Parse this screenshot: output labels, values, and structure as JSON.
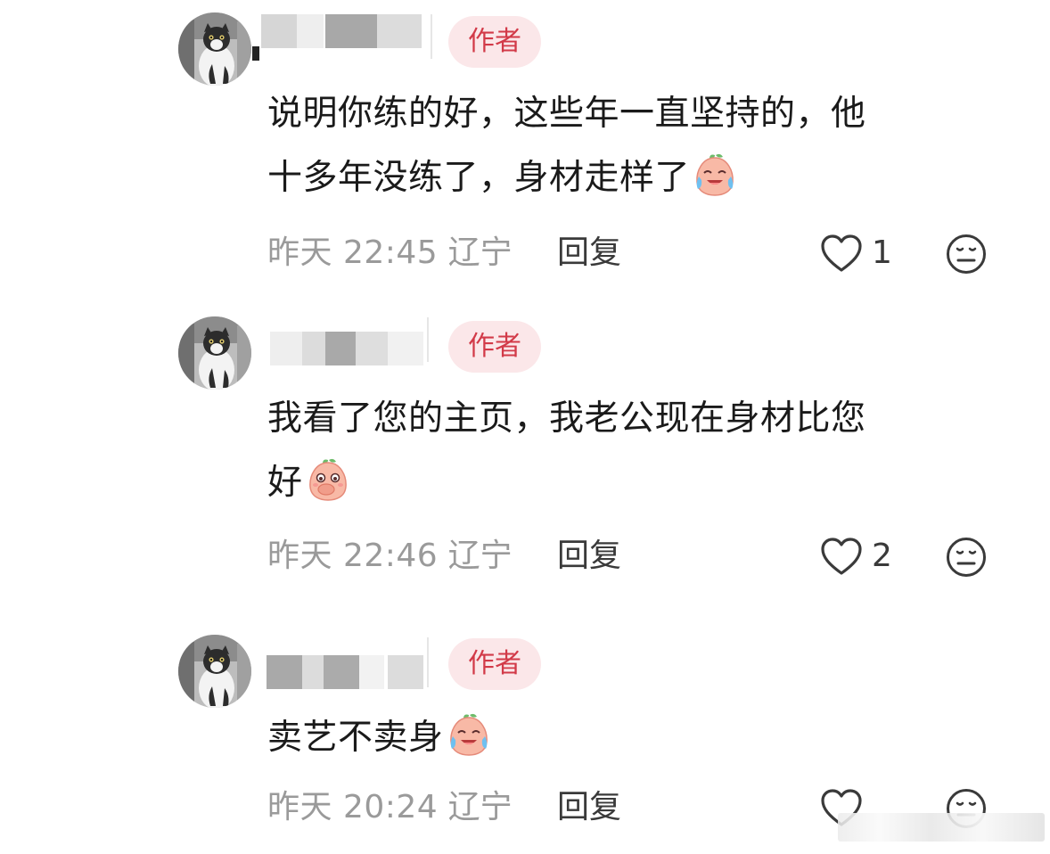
{
  "author_badge_label": "作者",
  "reply_label": "回复",
  "comments": [
    {
      "text_line1": "说明你练的好，这些年一直坚持的，他",
      "text_line2": "十多年没练了，身材走样了",
      "emoji": "crying-laughing-peach-emoji",
      "time": "昨天 22:45",
      "location": "辽宁",
      "like_count": "1"
    },
    {
      "text_line1": "我看了您的主页，我老公现在身材比您",
      "text_line2": "好",
      "emoji": "covering-mouth-peach-emoji",
      "time": "昨天 22:46",
      "location": "辽宁",
      "like_count": "2"
    },
    {
      "text_line1": "卖艺不卖身",
      "emoji": "crying-laughing-peach-emoji",
      "time": "昨天 20:24",
      "location": "辽宁",
      "like_count": ""
    }
  ],
  "icons": {
    "like": "heart-outline-icon",
    "emoji_react": "neutral-face-icon"
  },
  "colors": {
    "badge_bg": "#fbe7e9",
    "badge_text": "#d23a48",
    "meta_text": "#9a9a9a",
    "body_text": "#1a1a1a"
  }
}
